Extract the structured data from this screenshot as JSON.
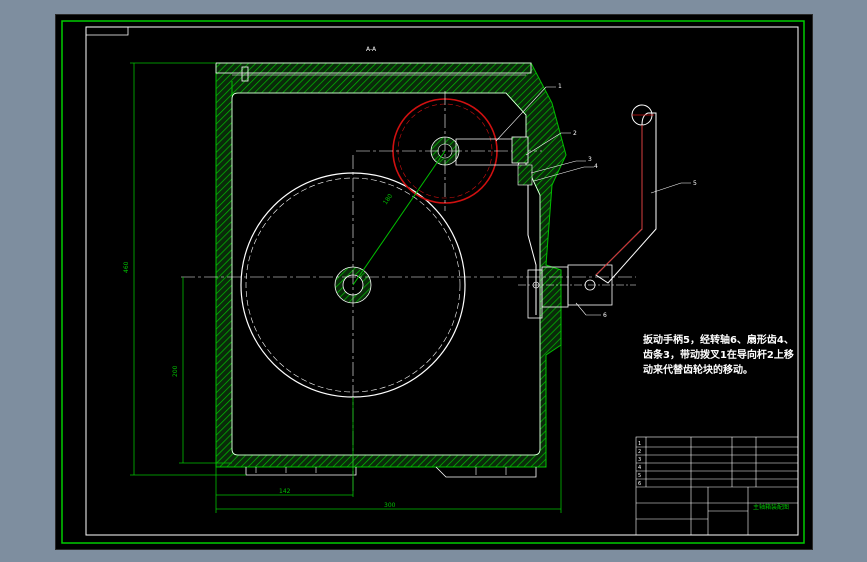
{
  "drawing": {
    "note": "扳动手柄5，经转轴6、扇形齿4、齿条3，带动拨叉1在导向杆2上移动来代替齿轮块的移动。",
    "part_labels": [
      "1",
      "2",
      "3",
      "4",
      "5",
      "6"
    ],
    "top_mark": "A-A",
    "title_block": {
      "title": "主轴箱装配图",
      "rows": [
        "1",
        "2",
        "3",
        "4",
        "5",
        "6"
      ]
    },
    "colors": {
      "background": "#000000",
      "border": "#00cc00",
      "hatch": "#00b000",
      "gear_red": "#d01010",
      "dim_line": "#00c000",
      "line": "#ffffff"
    }
  }
}
